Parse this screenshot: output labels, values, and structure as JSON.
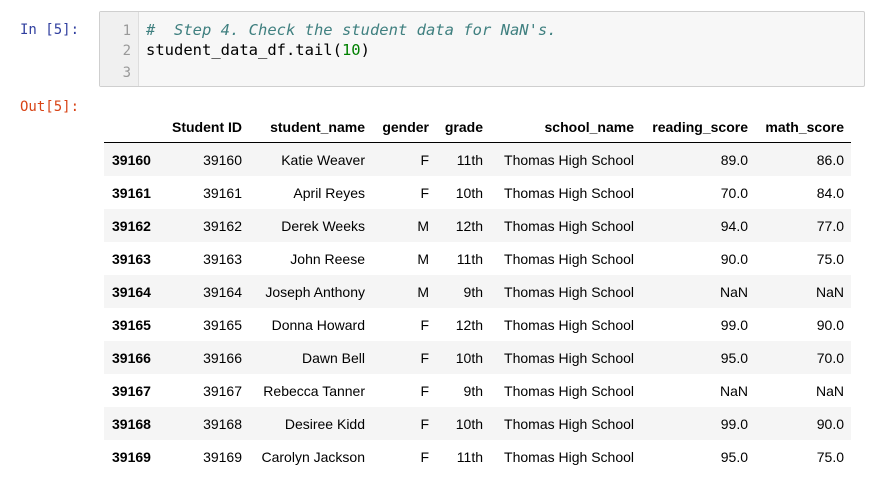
{
  "input_prompt": "In [5]:",
  "output_prompt": "Out[5]:",
  "code": {
    "line_numbers": [
      "1",
      "2",
      "3"
    ],
    "comment": "#  Step 4. Check the student data for NaN's.",
    "line2_prefix": "student_data_df.tail(",
    "line2_number": "10",
    "line2_suffix": ")"
  },
  "table": {
    "columns": [
      "Student ID",
      "student_name",
      "gender",
      "grade",
      "school_name",
      "reading_score",
      "math_score"
    ],
    "rows": [
      {
        "index": "39160",
        "student_id": "39160",
        "student_name": "Katie Weaver",
        "gender": "F",
        "grade": "11th",
        "school_name": "Thomas High School",
        "reading_score": "89.0",
        "math_score": "86.0"
      },
      {
        "index": "39161",
        "student_id": "39161",
        "student_name": "April Reyes",
        "gender": "F",
        "grade": "10th",
        "school_name": "Thomas High School",
        "reading_score": "70.0",
        "math_score": "84.0"
      },
      {
        "index": "39162",
        "student_id": "39162",
        "student_name": "Derek Weeks",
        "gender": "M",
        "grade": "12th",
        "school_name": "Thomas High School",
        "reading_score": "94.0",
        "math_score": "77.0"
      },
      {
        "index": "39163",
        "student_id": "39163",
        "student_name": "John Reese",
        "gender": "M",
        "grade": "11th",
        "school_name": "Thomas High School",
        "reading_score": "90.0",
        "math_score": "75.0"
      },
      {
        "index": "39164",
        "student_id": "39164",
        "student_name": "Joseph Anthony",
        "gender": "M",
        "grade": "9th",
        "school_name": "Thomas High School",
        "reading_score": "NaN",
        "math_score": "NaN"
      },
      {
        "index": "39165",
        "student_id": "39165",
        "student_name": "Donna Howard",
        "gender": "F",
        "grade": "12th",
        "school_name": "Thomas High School",
        "reading_score": "99.0",
        "math_score": "90.0"
      },
      {
        "index": "39166",
        "student_id": "39166",
        "student_name": "Dawn Bell",
        "gender": "F",
        "grade": "10th",
        "school_name": "Thomas High School",
        "reading_score": "95.0",
        "math_score": "70.0"
      },
      {
        "index": "39167",
        "student_id": "39167",
        "student_name": "Rebecca Tanner",
        "gender": "F",
        "grade": "9th",
        "school_name": "Thomas High School",
        "reading_score": "NaN",
        "math_score": "NaN"
      },
      {
        "index": "39168",
        "student_id": "39168",
        "student_name": "Desiree Kidd",
        "gender": "F",
        "grade": "10th",
        "school_name": "Thomas High School",
        "reading_score": "99.0",
        "math_score": "90.0"
      },
      {
        "index": "39169",
        "student_id": "39169",
        "student_name": "Carolyn Jackson",
        "gender": "F",
        "grade": "11th",
        "school_name": "Thomas High School",
        "reading_score": "95.0",
        "math_score": "75.0"
      }
    ]
  },
  "colors": {
    "input_prompt": "#303f9f",
    "output_prompt": "#d84315",
    "comment": "#408080",
    "number_literal": "#008000",
    "striped_row": "#f5f5f5"
  }
}
